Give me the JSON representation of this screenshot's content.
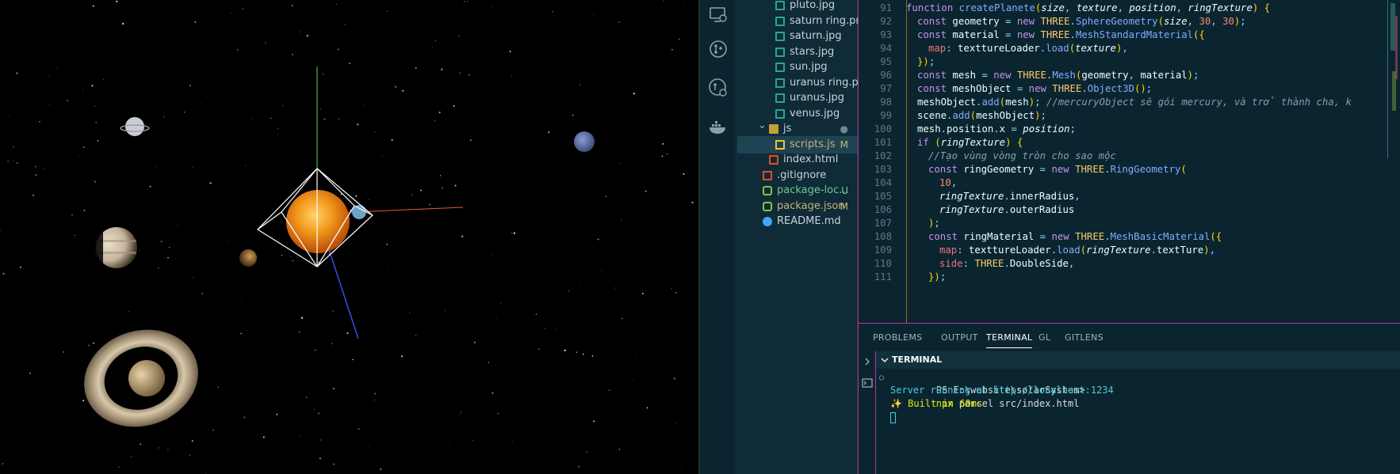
{
  "explorer": {
    "items": [
      {
        "name": "pluto.jpg",
        "type": "image",
        "badge": "",
        "indent": 2
      },
      {
        "name": "saturn ring.png",
        "type": "image",
        "badge": "",
        "indent": 2
      },
      {
        "name": "saturn.jpg",
        "type": "image",
        "badge": "",
        "indent": 2
      },
      {
        "name": "stars.jpg",
        "type": "image",
        "badge": "",
        "indent": 2
      },
      {
        "name": "sun.jpg",
        "type": "image",
        "badge": "",
        "indent": 2
      },
      {
        "name": "uranus ring.png",
        "type": "image",
        "badge": "",
        "indent": 2
      },
      {
        "name": "uranus.jpg",
        "type": "image",
        "badge": "",
        "indent": 2
      },
      {
        "name": "venus.jpg",
        "type": "image",
        "badge": "",
        "indent": 2
      },
      {
        "name": "js",
        "type": "folder",
        "badge": "●",
        "indent": 1
      },
      {
        "name": "scripts.js",
        "type": "js",
        "badge": "M",
        "indent": 2
      },
      {
        "name": "index.html",
        "type": "html",
        "badge": "",
        "indent": 1
      },
      {
        "name": ".gitignore",
        "type": "git",
        "badge": "",
        "indent": 0
      },
      {
        "name": "package-loc...",
        "type": "json",
        "badge": "U",
        "indent": 0
      },
      {
        "name": "package.json",
        "type": "json",
        "badge": "M",
        "indent": 0
      },
      {
        "name": "README.md",
        "type": "info",
        "badge": "",
        "indent": 0
      }
    ]
  },
  "editor": {
    "lines": [
      {
        "n": "91",
        "indent": 0,
        "tokens": [
          [
            "kw",
            "function "
          ],
          [
            "fn",
            "createPlanete"
          ],
          [
            "brk",
            "("
          ],
          [
            "param",
            "size"
          ],
          [
            "punc",
            ", "
          ],
          [
            "param",
            "texture"
          ],
          [
            "punc",
            ", "
          ],
          [
            "param",
            "position"
          ],
          [
            "punc",
            ", "
          ],
          [
            "param",
            "ringTexture"
          ],
          [
            "brk",
            ")"
          ],
          [
            "var",
            " "
          ],
          [
            "brk",
            "{"
          ]
        ]
      },
      {
        "n": "92",
        "indent": 1,
        "tokens": [
          [
            "kw",
            "const "
          ],
          [
            "var",
            "geometry "
          ],
          [
            "punc",
            "= "
          ],
          [
            "kw",
            "new "
          ],
          [
            "cls",
            "THREE"
          ],
          [
            "punc",
            "."
          ],
          [
            "fn",
            "SphereGeometry"
          ],
          [
            "brk",
            "("
          ],
          [
            "param",
            "size"
          ],
          [
            "punc",
            ", "
          ],
          [
            "num",
            "30"
          ],
          [
            "punc",
            ", "
          ],
          [
            "num",
            "30"
          ],
          [
            "brk",
            ")"
          ],
          [
            "punc",
            ";"
          ]
        ]
      },
      {
        "n": "93",
        "indent": 1,
        "tokens": [
          [
            "kw",
            "const "
          ],
          [
            "var",
            "material "
          ],
          [
            "punc",
            "= "
          ],
          [
            "kw",
            "new "
          ],
          [
            "cls",
            "THREE"
          ],
          [
            "punc",
            "."
          ],
          [
            "fn",
            "MeshStandardMaterial"
          ],
          [
            "brk",
            "({"
          ]
        ]
      },
      {
        "n": "94",
        "indent": 2,
        "tokens": [
          [
            "prop",
            "map"
          ],
          [
            "punc",
            ": "
          ],
          [
            "var",
            "texttureLoader"
          ],
          [
            "punc",
            "."
          ],
          [
            "fn",
            "load"
          ],
          [
            "brk",
            "("
          ],
          [
            "param",
            "texture"
          ],
          [
            "brk",
            ")"
          ],
          [
            "punc",
            ","
          ]
        ]
      },
      {
        "n": "95",
        "indent": 1,
        "tokens": [
          [
            "brk",
            "})"
          ],
          [
            "punc",
            ";"
          ]
        ]
      },
      {
        "n": "96",
        "indent": 1,
        "tokens": [
          [
            "kw",
            "const "
          ],
          [
            "var",
            "mesh "
          ],
          [
            "punc",
            "= "
          ],
          [
            "kw",
            "new "
          ],
          [
            "cls",
            "THREE"
          ],
          [
            "punc",
            "."
          ],
          [
            "fn",
            "Mesh"
          ],
          [
            "brk",
            "("
          ],
          [
            "var",
            "geometry"
          ],
          [
            "punc",
            ", "
          ],
          [
            "var",
            "material"
          ],
          [
            "brk",
            ")"
          ],
          [
            "punc",
            ";"
          ]
        ]
      },
      {
        "n": "97",
        "indent": 1,
        "tokens": [
          [
            "kw",
            "const "
          ],
          [
            "var",
            "meshObject "
          ],
          [
            "punc",
            "= "
          ],
          [
            "kw",
            "new "
          ],
          [
            "cls",
            "THREE"
          ],
          [
            "punc",
            "."
          ],
          [
            "fn",
            "Object3D"
          ],
          [
            "brk",
            "()"
          ],
          [
            "punc",
            ";"
          ]
        ]
      },
      {
        "n": "98",
        "indent": 1,
        "tokens": [
          [
            "var",
            "meshObject"
          ],
          [
            "punc",
            "."
          ],
          [
            "fn",
            "add"
          ],
          [
            "brk",
            "("
          ],
          [
            "var",
            "mesh"
          ],
          [
            "brk",
            ")"
          ],
          [
            "punc",
            "; "
          ],
          [
            "cmt",
            "//mercuryObject sẽ gói mercury, và trở thành cha, k"
          ]
        ]
      },
      {
        "n": "99",
        "indent": 1,
        "tokens": [
          [
            "var",
            "scene"
          ],
          [
            "punc",
            "."
          ],
          [
            "fn",
            "add"
          ],
          [
            "brk",
            "("
          ],
          [
            "var",
            "meshObject"
          ],
          [
            "brk",
            ")"
          ],
          [
            "punc",
            ";"
          ]
        ]
      },
      {
        "n": "100",
        "indent": 1,
        "tokens": [
          [
            "var",
            "mesh"
          ],
          [
            "punc",
            "."
          ],
          [
            "var",
            "position"
          ],
          [
            "punc",
            "."
          ],
          [
            "var",
            "x "
          ],
          [
            "punc",
            "= "
          ],
          [
            "param",
            "position"
          ],
          [
            "punc",
            ";"
          ]
        ]
      },
      {
        "n": "101",
        "indent": 1,
        "tokens": [
          [
            "kw",
            "if "
          ],
          [
            "brk",
            "("
          ],
          [
            "param",
            "ringTexture"
          ],
          [
            "brk",
            ")"
          ],
          [
            "var",
            " "
          ],
          [
            "brk",
            "{"
          ]
        ]
      },
      {
        "n": "102",
        "indent": 2,
        "tokens": [
          [
            "cmt",
            "//Tạo vùng vòng tròn cho sao mộc"
          ]
        ]
      },
      {
        "n": "103",
        "indent": 2,
        "tokens": [
          [
            "kw",
            "const "
          ],
          [
            "var",
            "ringGeometry "
          ],
          [
            "punc",
            "= "
          ],
          [
            "kw",
            "new "
          ],
          [
            "cls",
            "THREE"
          ],
          [
            "punc",
            "."
          ],
          [
            "fn",
            "RingGeometry"
          ],
          [
            "brk",
            "("
          ]
        ]
      },
      {
        "n": "104",
        "indent": 3,
        "tokens": [
          [
            "num",
            "10"
          ],
          [
            "punc",
            ","
          ]
        ]
      },
      {
        "n": "105",
        "indent": 3,
        "tokens": [
          [
            "param",
            "ringTexture"
          ],
          [
            "punc",
            "."
          ],
          [
            "var",
            "innerRadius"
          ],
          [
            "punc",
            ","
          ]
        ]
      },
      {
        "n": "106",
        "indent": 3,
        "tokens": [
          [
            "param",
            "ringTexture"
          ],
          [
            "punc",
            "."
          ],
          [
            "var",
            "outerRadius"
          ]
        ]
      },
      {
        "n": "107",
        "indent": 2,
        "tokens": [
          [
            "brk",
            ")"
          ],
          [
            "punc",
            ";"
          ]
        ]
      },
      {
        "n": "108",
        "indent": 2,
        "tokens": [
          [
            "kw",
            "const "
          ],
          [
            "var",
            "ringMaterial "
          ],
          [
            "punc",
            "= "
          ],
          [
            "kw",
            "new "
          ],
          [
            "cls",
            "THREE"
          ],
          [
            "punc",
            "."
          ],
          [
            "fn",
            "MeshBasicMaterial"
          ],
          [
            "brk",
            "({"
          ]
        ]
      },
      {
        "n": "109",
        "indent": 3,
        "tokens": [
          [
            "prop",
            "map"
          ],
          [
            "punc",
            ": "
          ],
          [
            "var",
            "texttureLoader"
          ],
          [
            "punc",
            "."
          ],
          [
            "fn",
            "load"
          ],
          [
            "brk",
            "("
          ],
          [
            "param",
            "ringTexture"
          ],
          [
            "punc",
            "."
          ],
          [
            "var",
            "textTure"
          ],
          [
            "brk",
            ")"
          ],
          [
            "punc",
            ","
          ]
        ]
      },
      {
        "n": "110",
        "indent": 3,
        "tokens": [
          [
            "prop",
            "side"
          ],
          [
            "punc",
            ": "
          ],
          [
            "cls",
            "THREE"
          ],
          [
            "punc",
            "."
          ],
          [
            "var",
            "DoubleSide"
          ],
          [
            "punc",
            ","
          ]
        ]
      },
      {
        "n": "111",
        "indent": 2,
        "tokens": [
          [
            "brk",
            "})"
          ],
          [
            "punc",
            ";"
          ]
        ]
      }
    ]
  },
  "panel": {
    "tabs": [
      "PROBLEMS",
      "OUTPUT",
      "TERMINAL",
      "GL",
      "GITLENS"
    ],
    "active_tab": "TERMINAL",
    "terminal_title": "TERMINAL",
    "prompt": "PS E:\\website\\solarSystem>",
    "command_bin": "npx",
    "command_args": " parcel src/index.html",
    "server_line": "Server running at http://localhost:1234",
    "built_line": "✨ Built in 60ms"
  },
  "colors": {
    "accent_border": "#b82fa8",
    "badge_modified": "#c8b37a",
    "badge_untracked": "#73c991",
    "terminal_server": "#4ec9e0",
    "terminal_built": "#e5e510"
  }
}
